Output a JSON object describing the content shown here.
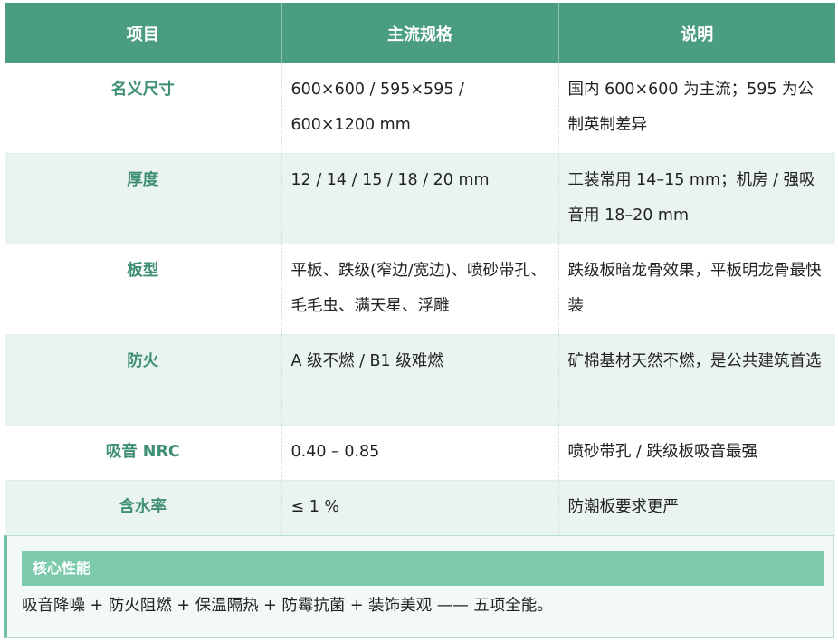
{
  "table": {
    "headers": [
      "项目",
      "主流规格",
      "说明"
    ],
    "rows": [
      {
        "item": "名义尺寸",
        "spec": "600×600 / 595×595 / 600×1200 mm",
        "note": "国内 600×600 为主流；595 为公制英制差异"
      },
      {
        "item": "厚度",
        "spec": "12 / 14 / 15 / 18 / 20 mm",
        "note": "工装常用 14–15 mm；机房 / 强吸音用 18–20 mm"
      },
      {
        "item": "板型",
        "spec": "平板、跌级(窄边/宽边)、喷砂带孔、毛毛虫、满天星、浮雕",
        "note": "跌级板暗龙骨效果，平板明龙骨最快装"
      },
      {
        "item": "防火",
        "spec": "A 级不燃 / B1 级难燃",
        "note": "矿棉基材天然不燃，是公共建筑首选"
      },
      {
        "item": "吸音 NRC",
        "spec": "0.40 – 0.85",
        "note": "喷砂带孔 / 跌级板吸音最强"
      },
      {
        "item": "含水率",
        "spec": "≤ 1 %",
        "note": "防潮板要求更严"
      }
    ]
  },
  "callout": {
    "title": "核心性能",
    "text": "吸音降噪 + 防火阻燃 + 保温隔热 + 防霉抗菌 + 装饰美观 —— 五项全能。"
  },
  "colors": {
    "header_bg": "#4a9d80",
    "item_text": "#3f8f72",
    "stripe": "#eaf4ef",
    "callout_head": "#7ecaad"
  }
}
